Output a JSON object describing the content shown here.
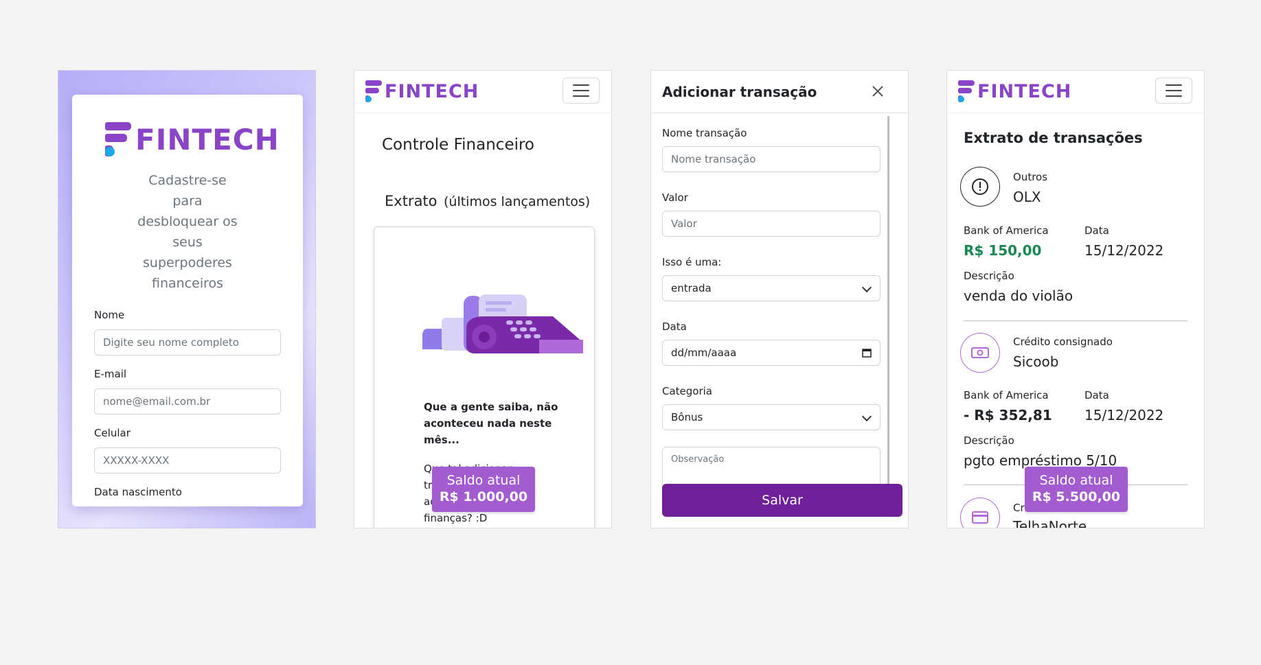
{
  "brand": {
    "name": "FINTECH",
    "purple": "#8a44c8",
    "blue": "#1ba7e8",
    "dark_purple": "#6f1f98",
    "green": "#198754"
  },
  "signup": {
    "tagline": [
      "Cadastre-se",
      "para",
      "desbloquear os",
      "seus",
      "superpoderes",
      "financeiros"
    ],
    "fields": [
      {
        "label": "Nome",
        "placeholder": "Digite seu nome completo"
      },
      {
        "label": "E-mail",
        "placeholder": "nome@email.com.br"
      },
      {
        "label": "Celular",
        "placeholder": "XXXXX-XXXX"
      },
      {
        "label": "Data nascimento"
      }
    ]
  },
  "dashboard": {
    "title": "Controle Financeiro",
    "section": "Extrato",
    "section_sub": "(últimos lançamentos)",
    "empty_message": [
      "Que a gente saiba, não",
      "aconteceu nada neste",
      "mês..."
    ],
    "suggestion": [
      "Que tal adicionar",
      "tr",
      "ac",
      "finanças? :D"
    ],
    "saldo_label": "Saldo atual",
    "saldo_value": "R$ 1.000,00"
  },
  "modal": {
    "title": "Adicionar transação",
    "fields": {
      "nome": {
        "label": "Nome transação",
        "placeholder": "Nome transação"
      },
      "valor": {
        "label": "Valor",
        "placeholder": "Valor"
      },
      "tipo": {
        "label": "Isso é uma:",
        "value": "entrada"
      },
      "data": {
        "label": "Data",
        "value": "dd/mm/aaaa"
      },
      "categoria": {
        "label": "Categoria",
        "value": "Bônus"
      },
      "obs": {
        "placeholder": "Observação"
      }
    },
    "save_label": "Salvar"
  },
  "statement": {
    "title": "Extrato de transações",
    "bank_label": "Bank of America",
    "date_label": "Data",
    "desc_label": "Descrição",
    "items": [
      {
        "category": "Outros",
        "name": "OLX",
        "value": "R$ 150,00",
        "date": "15/12/2022",
        "description": "venda do violão",
        "icon": "alert-circle-icon"
      },
      {
        "category": "Crédito consignado",
        "name": "Sicoob",
        "value": "- R$ 352,81",
        "date": "15/12/2022",
        "description": "pgto empréstimo 5/10",
        "icon": "cash-icon"
      },
      {
        "category": "Cr",
        "name": "TelhaNorte",
        "icon": "credit-card-icon"
      }
    ],
    "saldo_label": "Saldo atual",
    "saldo_value": "R$ 5.500,00"
  }
}
